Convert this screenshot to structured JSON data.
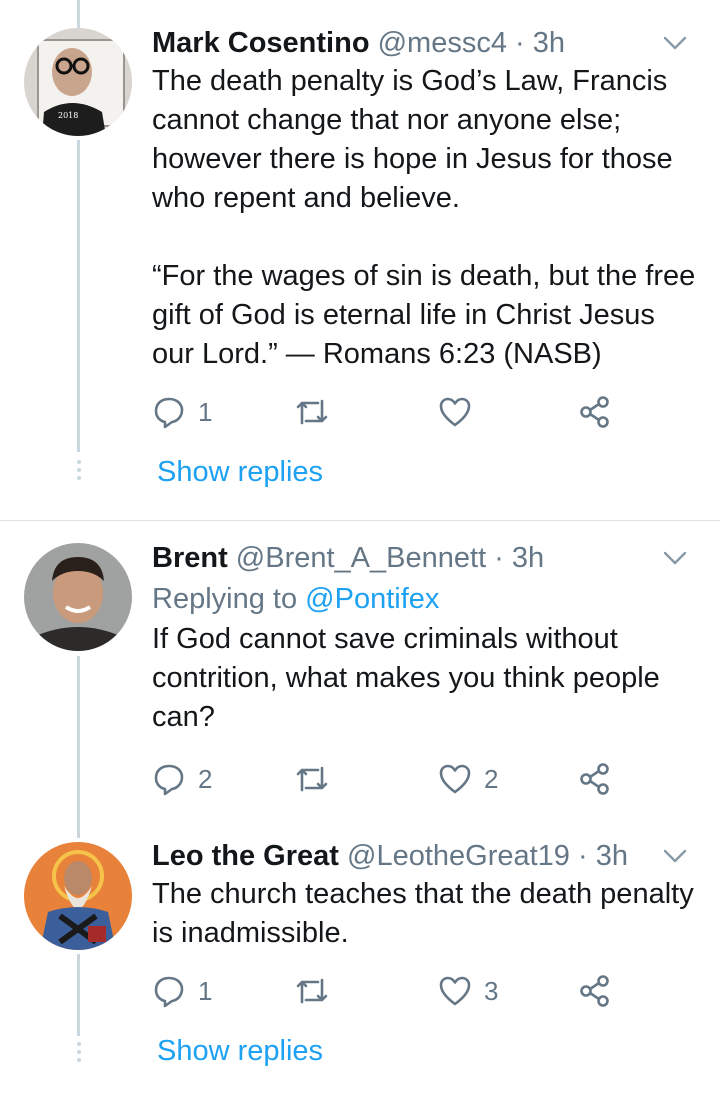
{
  "colors": {
    "accent": "#1da1f2",
    "muted": "#657786",
    "line": "#ccd6dd"
  },
  "tweets": [
    {
      "name": "Mark Cosentino",
      "handle": "@messc4 · 3h",
      "replying": null,
      "text": "The death penalty is God’s Law, Francis cannot change that nor anyone else; however there is hope in Jesus for those who repent and believe.\n\n“For the wages of sin is death, but the free gift of God is eternal life in Christ Jesus our Lord.” — Romans 6:23 (NASB)",
      "reply_count": "1",
      "retweet_count": "",
      "like_count": "",
      "show_replies": "Show replies"
    },
    {
      "name": "Brent",
      "handle": "@Brent_A_Bennett · 3h",
      "replying_prefix": "Replying to ",
      "replying_mention": "@Pontifex",
      "text": "If God cannot save criminals without contrition, what makes you think people can?",
      "reply_count": "2",
      "retweet_count": "",
      "like_count": "2"
    },
    {
      "name": "Leo the Great",
      "handle": "@LeotheGreat19 · 3h",
      "text": "The church teaches that the death penalty is inadmissible.",
      "reply_count": "1",
      "retweet_count": "",
      "like_count": "3",
      "show_replies": "Show replies"
    }
  ]
}
